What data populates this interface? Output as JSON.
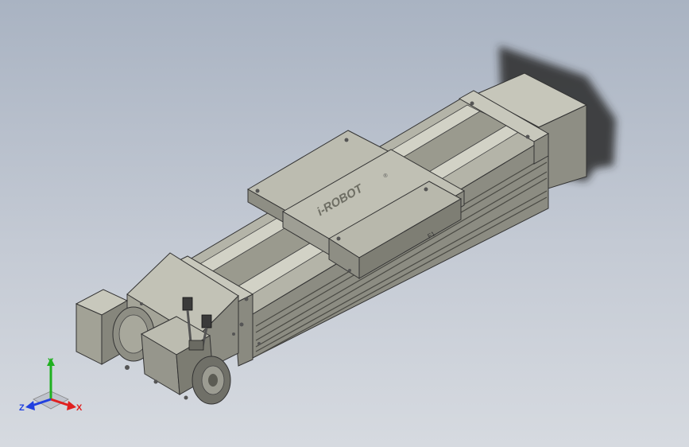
{
  "model": {
    "logo_text": "i-ROBOT",
    "logo_mark": "®",
    "part_mark": "F1",
    "part_name": "linear-module-servo-actuator"
  },
  "triad": {
    "x_label": "X",
    "y_label": "Y",
    "z_label": "Z",
    "x_color": "#e02020",
    "y_color": "#20b020",
    "z_color": "#2040e0"
  },
  "colors": {
    "background_top": "#a9b3c2",
    "background_bottom": "#d6dae0",
    "metal_light": "#bdbdb0",
    "metal_mid": "#9c9c90",
    "metal_dark": "#6e6e66",
    "shadow": "#3a3a3a"
  }
}
